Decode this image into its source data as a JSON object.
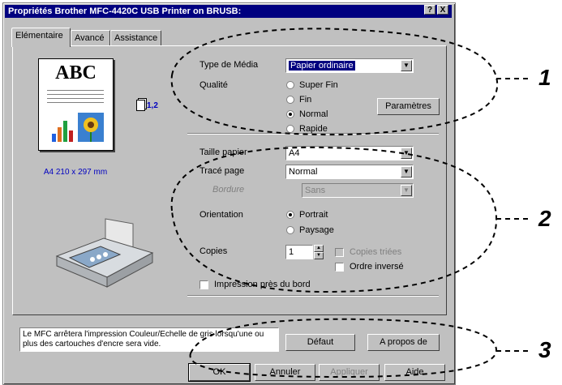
{
  "window": {
    "title": "Propriétés Brother MFC-4420C USB Printer on BRUSB:"
  },
  "titlebar_buttons": {
    "help": "?",
    "close": "X"
  },
  "tabs": [
    {
      "label": "Elémentaire"
    },
    {
      "label": "Avancé"
    },
    {
      "label": "Assistance"
    }
  ],
  "preview": {
    "page_text": "ABC",
    "paper_size": "A4 210 x 297 mm",
    "copies_indicator": "1,2"
  },
  "media": {
    "label": "Type de Média",
    "value": "Papier ordinaire",
    "quality_label": "Qualité",
    "quality_options": [
      "Super Fin",
      "Fin",
      "Normal",
      "Rapide"
    ],
    "quality_selected": "Normal",
    "settings_button": "Paramètres"
  },
  "page": {
    "size_label": "Taille papier",
    "size_value": "A4",
    "layout_label": "Tracé page",
    "layout_value": "Normal",
    "border_label": "Bordure",
    "border_value": "Sans",
    "orientation_label": "Orientation",
    "orientation_options": [
      "Portrait",
      "Paysage"
    ],
    "orientation_selected": "Portrait",
    "copies_label": "Copies",
    "copies_value": "1",
    "collate_label": "Copies triées",
    "reverse_label": "Ordre inversé",
    "edge_print_label": "Impression près du bord"
  },
  "footer": {
    "message": "Le MFC arrêtera l'impression Couleur/Echelle de gris lorsqu'une ou plus des cartouches d'encre sera vide.",
    "default_button": "Défaut",
    "about_button": "A propos de",
    "ok_button": "OK",
    "cancel_button": "Annuler",
    "apply_button": "Appliquer",
    "help_button": "Aide"
  },
  "callouts": [
    "1",
    "2",
    "3"
  ],
  "colors": {
    "titlebar": "#000080",
    "dialog": "#c0c0c0",
    "selection": "#000080"
  }
}
